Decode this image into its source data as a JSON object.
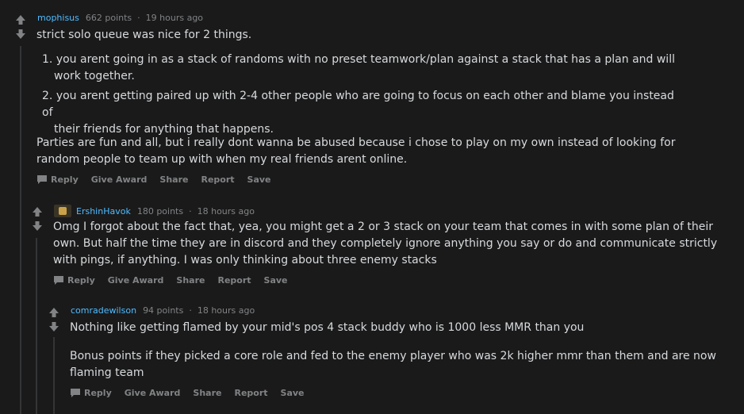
{
  "comments": [
    {
      "user": "mophisus",
      "points": "662 points",
      "sep": "·",
      "time": "19 hours ago",
      "body": {
        "intro": "strict solo queue was nice for 2 things.",
        "list": [
          {
            "num": "1.",
            "line1": "you arent going in as a stack of randoms with no preset teamwork/plan against a stack that has a plan and will",
            "line2": "work together."
          },
          {
            "num": "2.",
            "line1": "you arent getting paired up with 2-4 other people who are going to focus on each other and blame you instead of",
            "line2": "their friends for anything that happens."
          }
        ],
        "p1": "Parties are fun and all, but i really dont wanna be abused because i chose to play on my own instead of looking for",
        "p2": "random people to team up with when my real friends arent online."
      }
    },
    {
      "user": "ErshinHavok",
      "points": "180 points",
      "sep": "·",
      "time": "18 hours ago",
      "body": {
        "l1": "Omg I forgot about the fact that, yea, you might get a 2 or 3 stack on your team that comes in with some plan of their",
        "l2": "own. But half the time they are in discord and they completely ignore anything you say or do and communicate strictly",
        "l3": "with pings, if anything. I was only thinking about three enemy stacks"
      }
    },
    {
      "user": "comradewilson",
      "points": "94 points",
      "sep": "·",
      "time": "18 hours ago",
      "body": {
        "l1": "Nothing like getting flamed by your mid's pos 4 stack buddy who is 1000 less MMR than you",
        "p2a": "Bonus points if they picked a core role and fed to the enemy player who was 2k higher mmr than them and are now",
        "p2b": "flaming team"
      }
    }
  ],
  "actions": {
    "reply": "Reply",
    "give_award": "Give Award",
    "share": "Share",
    "report": "Report",
    "save": "Save"
  }
}
